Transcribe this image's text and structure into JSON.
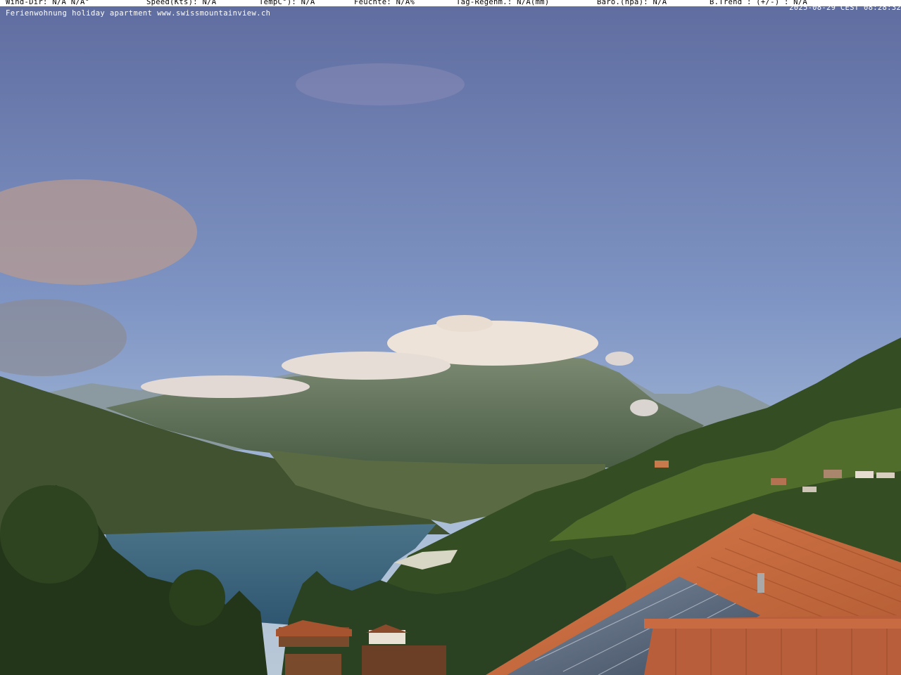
{
  "overlay": {
    "wind_dir": "Wind-Dir: N/A  N/A°",
    "speed": "Speed(Kts):    N/A",
    "temp": "TempC°):    N/A",
    "humidity": "Feuchte:   N/A%",
    "rain": "Tag-Regenm.:    N/A(mm)",
    "baro": "Baro.(hpa):    N/A",
    "trend": "B.Trend  : (+/-) : N/A",
    "caption": "Ferienwohnung holiday apartment www.swissmountainview.ch",
    "timestamp": "2025-08-29 CEST 08:28:32"
  },
  "colors": {
    "sky_top": "#5f6c9f",
    "sky_bottom": "#a9bdd8",
    "lake": "#3f6680",
    "roof": "#c4643a",
    "forest": "#3c5526"
  }
}
